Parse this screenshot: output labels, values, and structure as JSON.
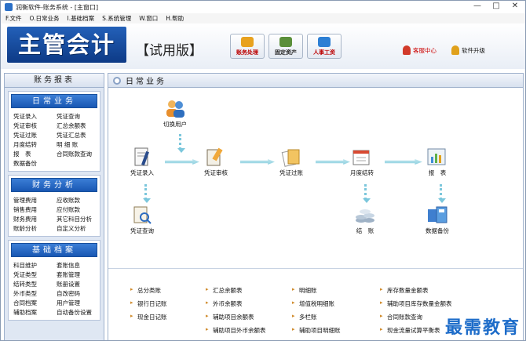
{
  "window": {
    "title": "润衡软件-账务系统 - [主窗口]",
    "min": "—",
    "max": "□",
    "close": "✕"
  },
  "menu": [
    "F.文件",
    "O.日常业务",
    "I.基础档案",
    "S.系统管理",
    "W.窗口",
    "H.帮助"
  ],
  "banner": {
    "logo": "主管会计",
    "edition": "【试用版】",
    "quick_buttons": [
      {
        "label": "账务处理",
        "color": "#e8a21f"
      },
      {
        "label": "固定资产",
        "color": "#5a8f3a"
      },
      {
        "label": "人事工资",
        "color": "#2c7fd4"
      }
    ],
    "service": "客服中心",
    "upgrade": "软件升级"
  },
  "sidebar": {
    "title": "账务报表",
    "groups": [
      {
        "title": "日常业务",
        "items": [
          "凭证录入",
          "凭证查询",
          "凭证审核",
          "汇总余额表",
          "凭证过账",
          "凭证汇总表",
          "月度结转",
          "明 细 账",
          "报　表",
          "合同账款查询",
          "数据备份",
          ""
        ]
      },
      {
        "title": "财务分析",
        "items": [
          "管理费用",
          "应收账款",
          "销售费用",
          "应付账款",
          "财务费用",
          "其它科目分析",
          "账龄分析",
          "自定义分析"
        ]
      },
      {
        "title": "基础档案",
        "items": [
          "科目维护",
          "套账信息",
          "凭证类型",
          "套账管理",
          "结转类型",
          "账册设置",
          "外币类型",
          "自改密码",
          "合同档案",
          "用户管理",
          "辅助档案",
          "自动备份设置"
        ]
      }
    ]
  },
  "main": {
    "title": "日常业务",
    "flow": {
      "switch_user": "切换用户",
      "entry": "凭证录入",
      "audit": "凭证审核",
      "post": "凭证过账",
      "monthly": "月度结转",
      "report": "报　表",
      "query": "凭证查询",
      "close": "结　账",
      "backup": "数据备份"
    },
    "links": [
      [
        "总分类账",
        "汇总余额表",
        "明细账",
        "库存数量金额表"
      ],
      [
        "银行日记账",
        "外币余额表",
        "增值税明细账",
        "辅助项目库存数量金额表"
      ],
      [
        "现金日记账",
        "辅助项目余额表",
        "多栏账",
        "合同账款查询"
      ],
      [
        "",
        "辅助项目外币余额表",
        "辅助项目明细账",
        "现金流量试算平衡表"
      ]
    ]
  },
  "watermark": "最需教育"
}
